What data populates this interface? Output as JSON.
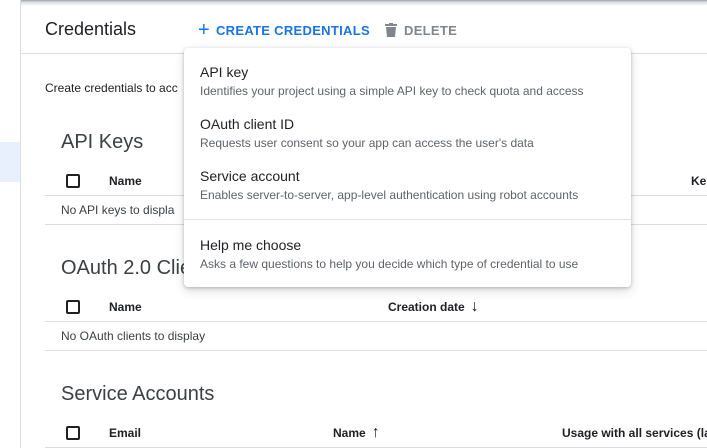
{
  "header": {
    "title": "Credentials",
    "create_label": "CREATE CREDENTIALS",
    "delete_label": "DELETE"
  },
  "intro": "Create credentials to acc",
  "sections": {
    "api_keys": {
      "title": "API Keys",
      "columns": [
        "Name",
        "Ke"
      ],
      "empty": "No API keys to displa"
    },
    "oauth": {
      "title": "OAuth 2.0 Clie",
      "columns": [
        "Name",
        "Creation date"
      ],
      "empty": "No OAuth clients to display"
    },
    "service_accounts": {
      "title": "Service Accounts",
      "columns": [
        "Email",
        "Name",
        "Usage with all services (las"
      ]
    }
  },
  "menu": {
    "items": [
      {
        "title": "API key",
        "desc": "Identifies your project using a simple API key to check quota and access"
      },
      {
        "title": "OAuth client ID",
        "desc": "Requests user consent so your app can access the user's data"
      },
      {
        "title": "Service account",
        "desc": "Enables server-to-server, app-level authentication using robot accounts"
      },
      {
        "title": "Help me choose",
        "desc": "Asks a few questions to help you decide which type of credential to use"
      }
    ]
  },
  "icons": {
    "create": "plus-icon",
    "delete": "trash-icon",
    "sort_desc": "arrow-down-icon",
    "sort_asc": "arrow-up-icon"
  },
  "colors": {
    "accent": "#1a73e8",
    "muted": "#80868b",
    "divider": "#dadce0"
  }
}
